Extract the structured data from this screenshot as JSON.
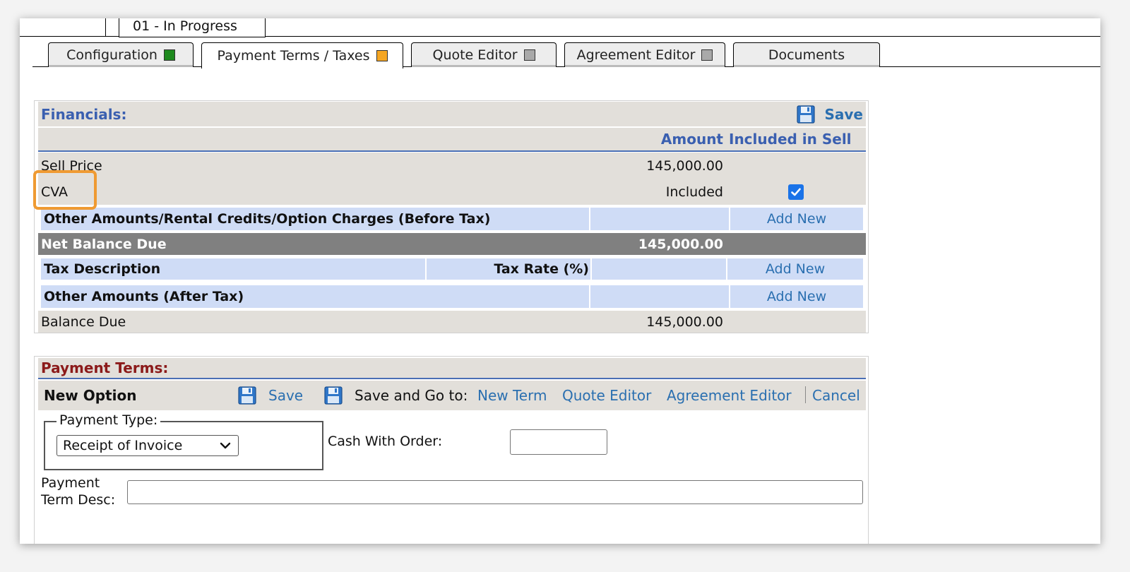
{
  "status": {
    "label": "01 - In Progress"
  },
  "tabs": [
    {
      "label": "Configuration",
      "status_color": "#1e8a1e"
    },
    {
      "label": "Payment Terms / Taxes",
      "status_color": "#f5a623"
    },
    {
      "label": "Quote Editor",
      "status_color": "#a9a9a9"
    },
    {
      "label": "Agreement Editor",
      "status_color": "#a9a9a9"
    },
    {
      "label": "Documents"
    }
  ],
  "financials": {
    "title": "Financials:",
    "save_label": "Save",
    "col_amount": "Amount",
    "col_included": "Included in Sell",
    "sell_price": {
      "label": "Sell Price",
      "amount": "145,000.00"
    },
    "cva": {
      "label": "CVA",
      "amount": "Included",
      "included_checked": true
    },
    "other_before_tax": {
      "label": "Other Amounts/Rental Credits/Option Charges (Before Tax)",
      "action": "Add New"
    },
    "net_balance": {
      "label": "Net Balance Due",
      "amount": "145,000.00"
    },
    "tax": {
      "label": "Tax Description",
      "rate_label": "Tax Rate (%)",
      "action": "Add New"
    },
    "other_after_tax": {
      "label": "Other Amounts (After Tax)",
      "action": "Add New"
    },
    "balance_due": {
      "label": "Balance Due",
      "amount": "145,000.00"
    }
  },
  "payment_terms": {
    "title": "Payment Terms:",
    "option_label": "New Option",
    "save_label": "Save",
    "save_and_go_label": "Save and Go to:",
    "links": [
      "New Term",
      "Quote Editor",
      "Agreement Editor"
    ],
    "cancel_label": "Cancel",
    "payment_type_legend": "Payment Type:",
    "payment_type_value": "Receipt of Invoice",
    "cash_with_order_label": "Cash With Order:",
    "cash_with_order_value": "",
    "desc_label_1": "Payment",
    "desc_label_2": "Term Desc:",
    "desc_value": ""
  },
  "colors": {
    "header_blue": "#3a5fb0",
    "link_blue": "#2a6fb0",
    "payment_title": "#8b1a1a",
    "highlight": "#ef9a32"
  }
}
